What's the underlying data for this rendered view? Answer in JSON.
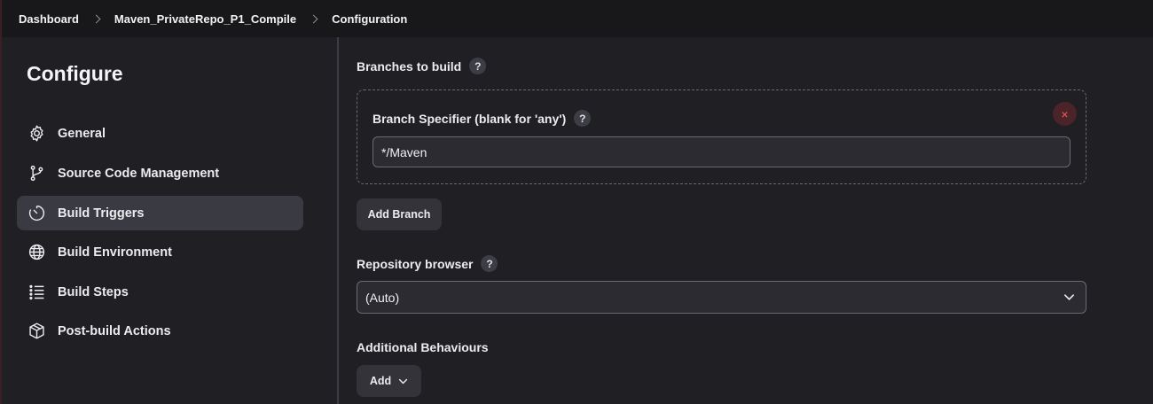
{
  "breadcrumb": {
    "items": [
      "Dashboard",
      "Maven_PrivateRepo_P1_Compile",
      "Configuration"
    ]
  },
  "sidebar": {
    "title": "Configure",
    "items": [
      {
        "label": "General",
        "icon": "gear-icon",
        "active": false
      },
      {
        "label": "Source Code Management",
        "icon": "git-branch-icon",
        "active": false
      },
      {
        "label": "Build Triggers",
        "icon": "timer-icon",
        "active": true
      },
      {
        "label": "Build Environment",
        "icon": "globe-icon",
        "active": false
      },
      {
        "label": "Build Steps",
        "icon": "list-icon",
        "active": false
      },
      {
        "label": "Post-build Actions",
        "icon": "package-icon",
        "active": false
      }
    ]
  },
  "main": {
    "branches_label": "Branches to build",
    "help_glyph": "?",
    "branch_specifier_label": "Branch Specifier (blank for 'any')",
    "branch_specifier_value": "*/Maven",
    "remove_glyph": "×",
    "add_branch_label": "Add Branch",
    "repo_browser_label": "Repository browser",
    "repo_browser_value": "(Auto)",
    "additional_behaviours_label": "Additional Behaviours",
    "add_label": "Add"
  },
  "colors": {
    "background": "#1f1f24",
    "topbar": "#18181b",
    "active_nav": "#3a3a42",
    "remove_accent": "#ff5a5a"
  }
}
